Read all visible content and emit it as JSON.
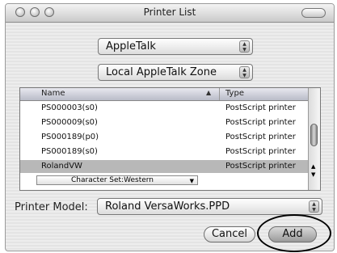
{
  "window": {
    "title": "Printer List"
  },
  "connection_popup": {
    "value": "AppleTalk"
  },
  "zone_popup": {
    "value": "Local AppleTalk Zone"
  },
  "printer_list": {
    "columns": [
      "Name",
      "Type"
    ],
    "rows": [
      {
        "name": "PS000003(s0)",
        "type": "PostScript printer"
      },
      {
        "name": "PS000009(s0)",
        "type": "PostScript printer"
      },
      {
        "name": "PS000189(p0)",
        "type": "PostScript printer"
      },
      {
        "name": "PS000189(s0)",
        "type": "PostScript printer"
      },
      {
        "name": "RolandVW",
        "type": "PostScript printer",
        "selected": true
      }
    ],
    "character_set": "Character Set:Western"
  },
  "printer_model": {
    "label": "Printer Model:",
    "value": "Roland VersaWorks.PPD"
  },
  "buttons": {
    "cancel": "Cancel",
    "add": "Add"
  }
}
